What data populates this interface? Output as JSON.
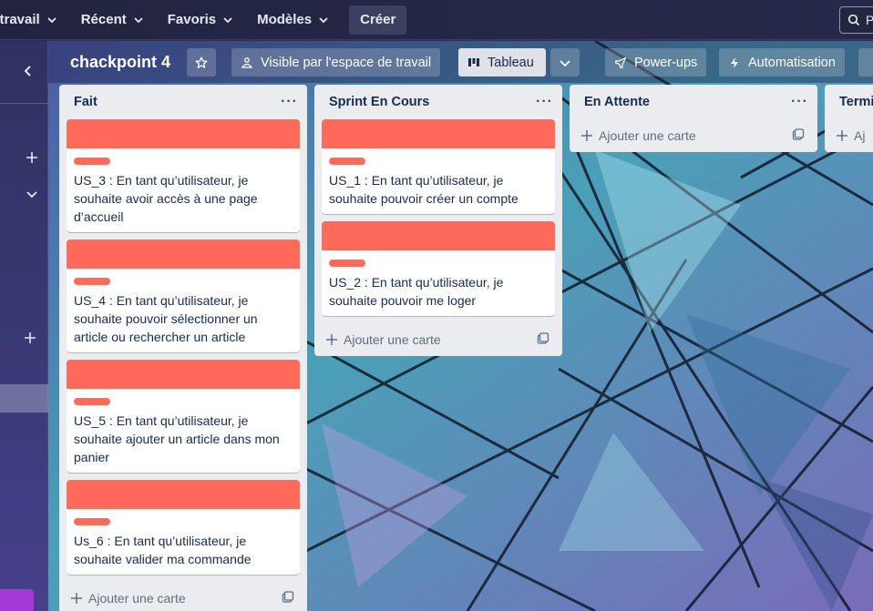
{
  "topnav": {
    "workspace_label": "e travail",
    "recent_label": "Récent",
    "favorites_label": "Favoris",
    "templates_label": "Modèles",
    "create_label": "Créer",
    "search_placeholder": "P"
  },
  "board": {
    "title": "chackpoint 4",
    "visibility_label": "Visible par l'espace de travail",
    "view_label": "Tableau",
    "powerups_label": "Power-ups",
    "automation_label": "Automatisation"
  },
  "lists": [
    {
      "title": "Fait",
      "cards": [
        {
          "text": "US_3 : En tant qu’utilisateur, je souhaite avoir accès à une page d’accueil"
        },
        {
          "text": "US_4 : En tant qu’utilisateur, je souhaite pouvoir sélectionner un article ou rechercher un article"
        },
        {
          "text": "US_5 : En tant qu’utilisateur, je souhaite ajouter un article dans mon panier"
        },
        {
          "text": "Us_6 : En tant qu’utilisateur, je souhaite valider ma commande"
        }
      ],
      "add_card_label": "Ajouter une carte"
    },
    {
      "title": "Sprint En Cours",
      "cards": [
        {
          "text": "US_1 : En tant qu’utilisateur, je souhaite pouvoir créer un compte"
        },
        {
          "text": "US_2 : En tant qu’utilisateur, je souhaite pouvoir me loger"
        }
      ],
      "add_card_label": "Ajouter une carte"
    },
    {
      "title": "En Attente",
      "cards": [],
      "add_card_label": "Ajouter une carte"
    },
    {
      "title": "Termi",
      "cards": [],
      "add_card_label": "Aj"
    }
  ],
  "colors": {
    "label_red": "#ff6a5b",
    "list_bg": "#ebecf0",
    "topbar_bg": "#22243f"
  },
  "icons": {
    "star": "star-icon",
    "visibility": "workspace-visibility-icon",
    "board": "board-view-icon",
    "powerups": "rocket-icon",
    "automation": "bolt-icon",
    "search": "search-icon"
  }
}
